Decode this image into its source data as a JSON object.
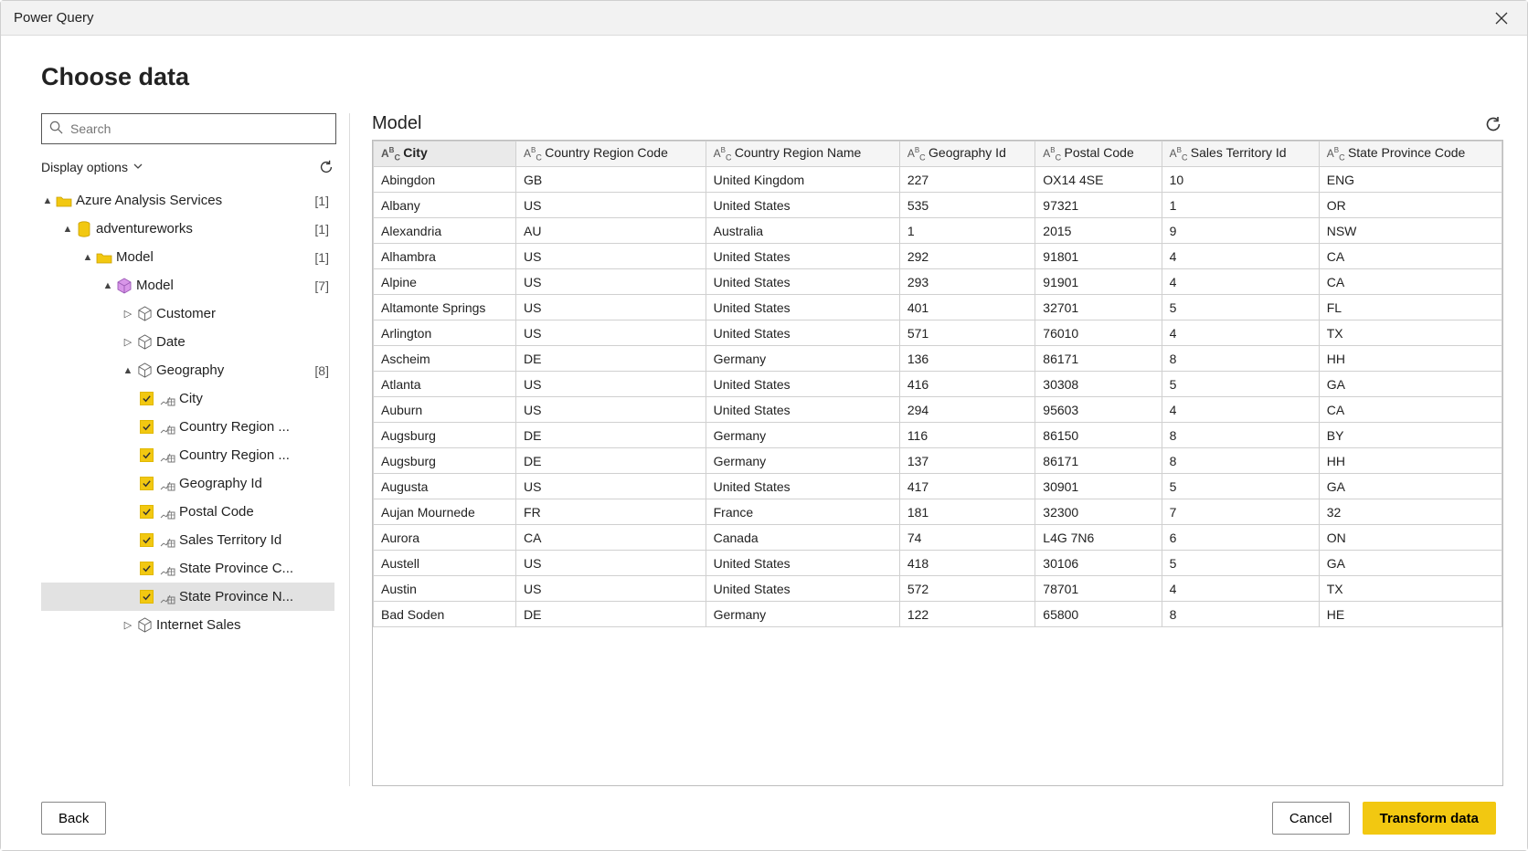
{
  "window": {
    "title": "Power Query"
  },
  "heading": "Choose data",
  "search": {
    "placeholder": "Search"
  },
  "display_options": {
    "label": "Display options"
  },
  "tree": {
    "root": {
      "label": "Azure Analysis Services",
      "count": "[1]",
      "expanded": true,
      "icon": "folder",
      "children": {
        "db": {
          "label": "adventureworks",
          "count": "[1]",
          "expanded": true,
          "icon": "database",
          "children": {
            "model_folder": {
              "label": "Model",
              "count": "[1]",
              "expanded": true,
              "icon": "folder",
              "children": {
                "model": {
                  "label": "Model",
                  "count": "[7]",
                  "expanded": true,
                  "icon": "cube",
                  "tables": [
                    {
                      "label": "Customer",
                      "expanded": false,
                      "icon": "cube-outline"
                    },
                    {
                      "label": "Date",
                      "expanded": false,
                      "icon": "cube-outline"
                    },
                    {
                      "label": "Geography",
                      "count": "[8]",
                      "expanded": true,
                      "icon": "cube-outline",
                      "columns": [
                        {
                          "label": "City",
                          "checked": true
                        },
                        {
                          "label": "Country Region ...",
                          "checked": true
                        },
                        {
                          "label": "Country Region ...",
                          "checked": true
                        },
                        {
                          "label": "Geography Id",
                          "checked": true
                        },
                        {
                          "label": "Postal Code",
                          "checked": true
                        },
                        {
                          "label": "Sales Territory Id",
                          "checked": true
                        },
                        {
                          "label": "State Province C...",
                          "checked": true
                        },
                        {
                          "label": "State Province N...",
                          "checked": true,
                          "selected": true
                        }
                      ]
                    },
                    {
                      "label": "Internet Sales",
                      "expanded": false,
                      "icon": "cube-outline"
                    }
                  ]
                }
              }
            }
          }
        }
      }
    }
  },
  "table": {
    "title": "Model",
    "columns": [
      {
        "name": "City",
        "sorted": true
      },
      {
        "name": "Country Region Code"
      },
      {
        "name": "Country Region Name"
      },
      {
        "name": "Geography Id"
      },
      {
        "name": "Postal Code"
      },
      {
        "name": "Sales Territory Id"
      },
      {
        "name": "State Province Code"
      }
    ],
    "rows": [
      [
        "Abingdon",
        "GB",
        "United Kingdom",
        "227",
        "OX14 4SE",
        "10",
        "ENG"
      ],
      [
        "Albany",
        "US",
        "United States",
        "535",
        "97321",
        "1",
        "OR"
      ],
      [
        "Alexandria",
        "AU",
        "Australia",
        "1",
        "2015",
        "9",
        "NSW"
      ],
      [
        "Alhambra",
        "US",
        "United States",
        "292",
        "91801",
        "4",
        "CA"
      ],
      [
        "Alpine",
        "US",
        "United States",
        "293",
        "91901",
        "4",
        "CA"
      ],
      [
        "Altamonte Springs",
        "US",
        "United States",
        "401",
        "32701",
        "5",
        "FL"
      ],
      [
        "Arlington",
        "US",
        "United States",
        "571",
        "76010",
        "4",
        "TX"
      ],
      [
        "Ascheim",
        "DE",
        "Germany",
        "136",
        "86171",
        "8",
        "HH"
      ],
      [
        "Atlanta",
        "US",
        "United States",
        "416",
        "30308",
        "5",
        "GA"
      ],
      [
        "Auburn",
        "US",
        "United States",
        "294",
        "95603",
        "4",
        "CA"
      ],
      [
        "Augsburg",
        "DE",
        "Germany",
        "116",
        "86150",
        "8",
        "BY"
      ],
      [
        "Augsburg",
        "DE",
        "Germany",
        "137",
        "86171",
        "8",
        "HH"
      ],
      [
        "Augusta",
        "US",
        "United States",
        "417",
        "30901",
        "5",
        "GA"
      ],
      [
        "Aujan Mournede",
        "FR",
        "France",
        "181",
        "32300",
        "7",
        "32"
      ],
      [
        "Aurora",
        "CA",
        "Canada",
        "74",
        "L4G 7N6",
        "6",
        "ON"
      ],
      [
        "Austell",
        "US",
        "United States",
        "418",
        "30106",
        "5",
        "GA"
      ],
      [
        "Austin",
        "US",
        "United States",
        "572",
        "78701",
        "4",
        "TX"
      ],
      [
        "Bad Soden",
        "DE",
        "Germany",
        "122",
        "65800",
        "8",
        "HE"
      ]
    ]
  },
  "footer": {
    "back": "Back",
    "cancel": "Cancel",
    "transform": "Transform data"
  }
}
